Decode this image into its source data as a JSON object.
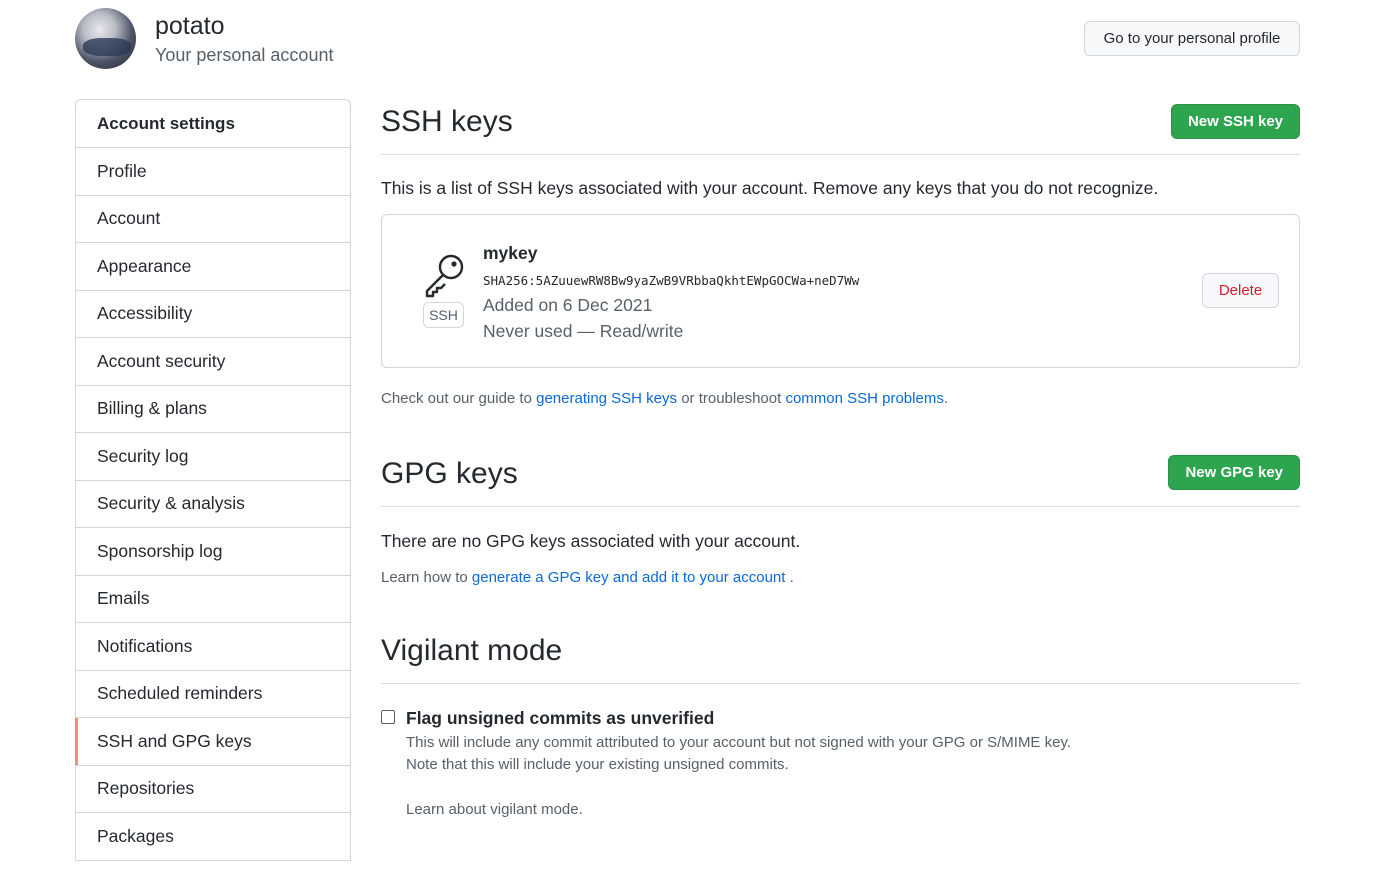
{
  "header": {
    "account_name": "potato",
    "account_subtitle": "Your personal account",
    "profile_button": "Go to your personal profile"
  },
  "sidebar": {
    "heading": "Account settings",
    "items": [
      {
        "label": "Profile"
      },
      {
        "label": "Account"
      },
      {
        "label": "Appearance"
      },
      {
        "label": "Accessibility"
      },
      {
        "label": "Account security"
      },
      {
        "label": "Billing & plans"
      },
      {
        "label": "Security log"
      },
      {
        "label": "Security & analysis"
      },
      {
        "label": "Sponsorship log"
      },
      {
        "label": "Emails"
      },
      {
        "label": "Notifications"
      },
      {
        "label": "Scheduled reminders"
      },
      {
        "label": "SSH and GPG keys",
        "active": true
      },
      {
        "label": "Repositories"
      },
      {
        "label": "Packages"
      }
    ]
  },
  "ssh": {
    "title": "SSH keys",
    "new_button": "New SSH key",
    "intro": "This is a list of SSH keys associated with your account. Remove any keys that you do not recognize.",
    "key": {
      "name": "mykey",
      "fingerprint": "SHA256:5AZuuewRW8Bw9yaZwB9VRbbaQkhtEWpGOCWa+neD7Ww",
      "added": "Added on 6 Dec 2021",
      "usage": "Never used — Read/write",
      "badge": "SSH",
      "delete_button": "Delete"
    },
    "guide_prefix": "Check out our guide to ",
    "guide_link1": "generating SSH keys",
    "guide_mid": " or troubleshoot ",
    "guide_link2": "common SSH problems",
    "guide_suffix": "."
  },
  "gpg": {
    "title": "GPG keys",
    "new_button": "New GPG key",
    "empty_text": "There are no GPG keys associated with your account.",
    "learn_prefix": "Learn how to ",
    "learn_link": "generate a GPG key and add it to your account",
    "learn_suffix": " ."
  },
  "vigilant": {
    "title": "Vigilant mode",
    "checkbox_label": "Flag unsigned commits as unverified",
    "checked": false,
    "desc1": "This will include any commit attributed to your account but not signed with your GPG or S/MIME key.",
    "desc2": "Note that this will include your existing unsigned commits.",
    "learn_link": "Learn about vigilant mode."
  },
  "colors": {
    "primary_green": "#2da44e",
    "link_blue": "#0969da",
    "danger_red": "#cf222e",
    "active_marker": "#fd8c73"
  }
}
